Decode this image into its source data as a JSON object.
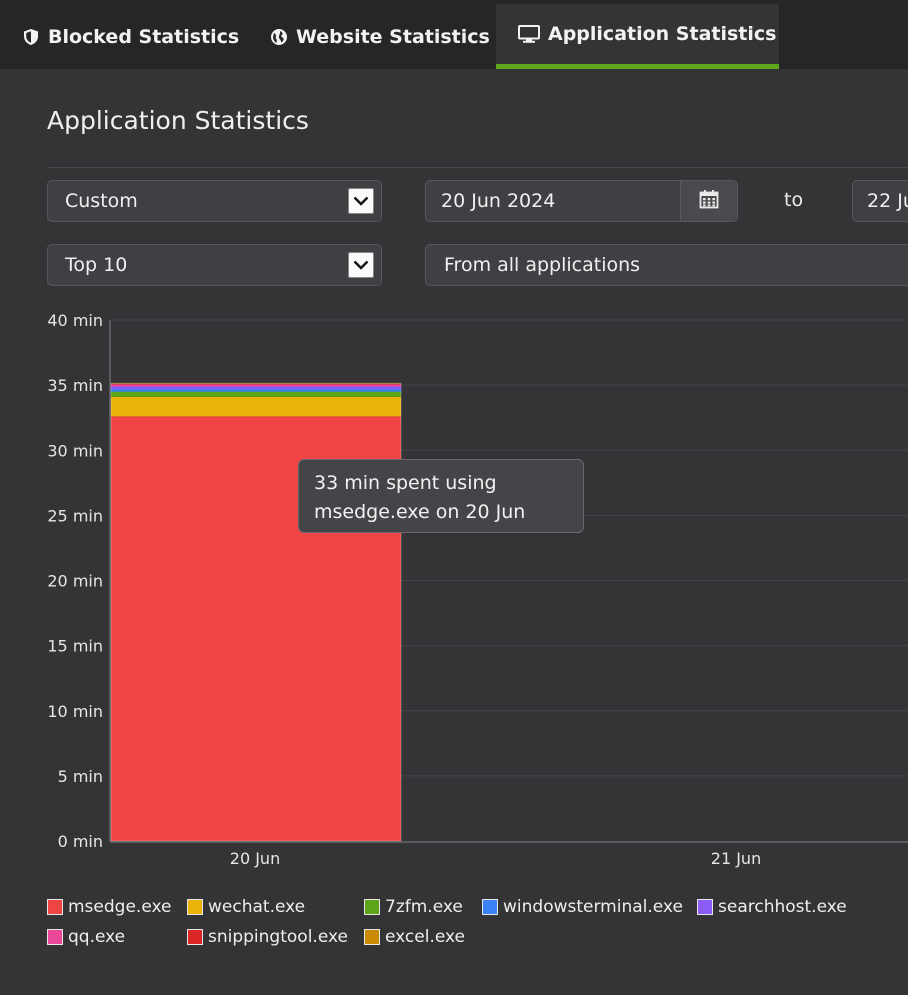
{
  "tabs": [
    {
      "label": "Blocked Statistics",
      "icon": "shield-icon",
      "active": false
    },
    {
      "label": "Website Statistics",
      "icon": "globe-icon",
      "active": false
    },
    {
      "label": "Application Statistics",
      "icon": "monitor-icon",
      "active": true
    }
  ],
  "page_title": "Application Statistics",
  "filters": {
    "range_select": "Custom",
    "start_date": "20 Jun 2024",
    "to_label": "to",
    "end_date": "22 Ju",
    "top_select": "Top 10",
    "app_filter": "From all applications"
  },
  "tooltip": {
    "line1": "33 min spent using",
    "line2": "msedge.exe on 20 Jun"
  },
  "colors": {
    "accent_tab": "#5ea51a",
    "msedge": "#ef4444",
    "wechat": "#eab308",
    "7zfm": "#5ea51a",
    "windowsterminal": "#3b82f6",
    "searchhost": "#8b5cf6",
    "qq": "#ec4899",
    "snippingtool": "#dc2626",
    "excel": "#ca8a04"
  },
  "chart_data": {
    "type": "bar",
    "stacked": true,
    "categories": [
      "20 Jun",
      "21 Jun"
    ],
    "ylim": [
      0,
      40
    ],
    "y_ticks": [
      "0 min",
      "5 min",
      "10 min",
      "15 min",
      "20 min",
      "25 min",
      "30 min",
      "35 min",
      "40 min"
    ],
    "grid": true,
    "legend_position": "bottom",
    "series": [
      {
        "name": "msedge.exe",
        "color": "#ef4444",
        "values": [
          32.6,
          0
        ]
      },
      {
        "name": "wechat.exe",
        "color": "#eab308",
        "values": [
          1.5,
          0
        ]
      },
      {
        "name": "7zfm.exe",
        "color": "#5ea51a",
        "values": [
          0.4,
          0
        ]
      },
      {
        "name": "windowsterminal.exe",
        "color": "#3b82f6",
        "values": [
          0.2,
          0
        ]
      },
      {
        "name": "searchhost.exe",
        "color": "#8b5cf6",
        "values": [
          0.2,
          0
        ]
      },
      {
        "name": "qq.exe",
        "color": "#ec4899",
        "values": [
          0.15,
          0
        ]
      },
      {
        "name": "snippingtool.exe",
        "color": "#dc2626",
        "values": [
          0.05,
          0
        ]
      },
      {
        "name": "excel.exe",
        "color": "#ca8a04",
        "values": [
          0.05,
          0
        ]
      }
    ]
  }
}
